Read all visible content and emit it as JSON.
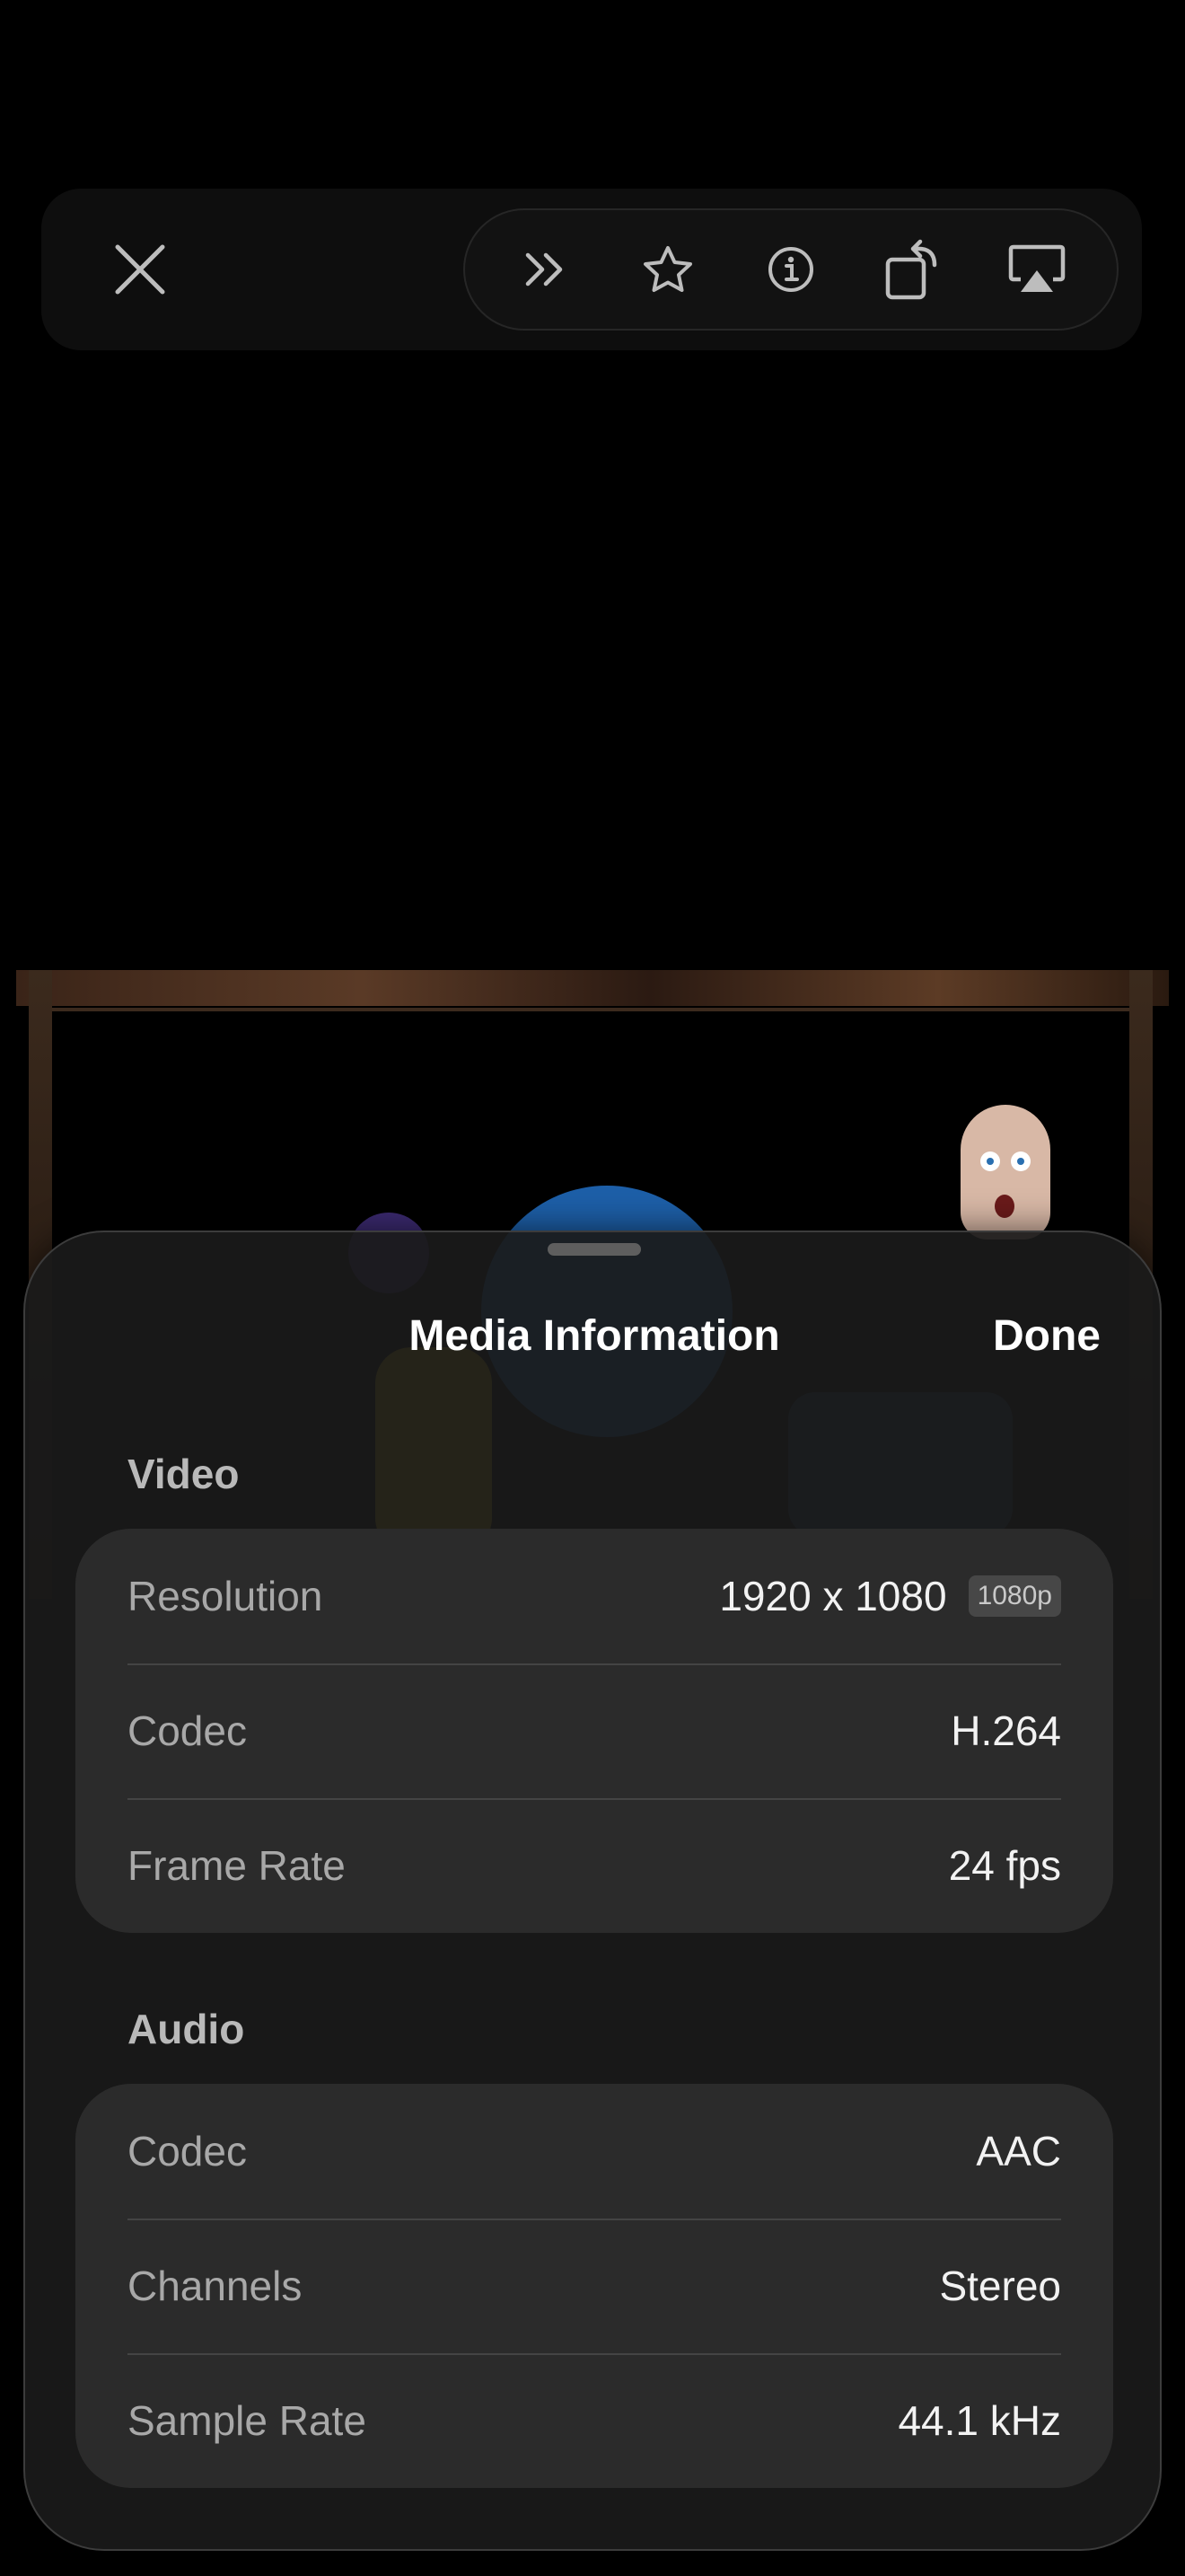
{
  "toolbar": {
    "icons": [
      "close-icon",
      "forward-skip-icon",
      "star-icon",
      "info-icon",
      "rotate-icon",
      "airplay-icon"
    ]
  },
  "sheet": {
    "title": "Media Information",
    "done_label": "Done",
    "sections": {
      "video": {
        "header": "Video",
        "rows": [
          {
            "label": "Resolution",
            "value": "1920 x 1080",
            "badge": "1080p"
          },
          {
            "label": "Codec",
            "value": "H.264"
          },
          {
            "label": "Frame Rate",
            "value": "24 fps"
          }
        ]
      },
      "audio": {
        "header": "Audio",
        "rows": [
          {
            "label": "Codec",
            "value": "AAC"
          },
          {
            "label": "Channels",
            "value": "Stereo"
          },
          {
            "label": "Sample Rate",
            "value": "44.1 kHz"
          }
        ]
      }
    }
  }
}
